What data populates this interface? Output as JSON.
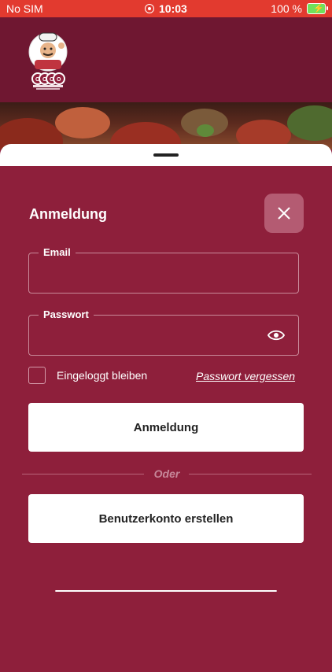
{
  "status_bar": {
    "carrier": "No SIM",
    "time": "10:03",
    "battery": "100 %"
  },
  "header": {
    "logo": {
      "name": "COCO",
      "tagline": "PIZZA & BURGER",
      "subtitle": "Spezialitäten"
    },
    "user_icon": "user-icon",
    "menu_icon": "hamburger-menu-icon"
  },
  "login": {
    "title": "Anmeldung",
    "close_icon": "close-icon",
    "email_label": "Email",
    "email_value": "",
    "password_label": "Passwort",
    "password_value": "",
    "remember_label": "Eingeloggt bleiben",
    "remember_checked": false,
    "forgot_label": "Passwort vergessen",
    "login_button": "Anmeldung",
    "or_text": "Oder",
    "register_button": "Benutzerkonto erstellen"
  },
  "colors": {
    "primary": "#8e1f3b",
    "header": "#6f1731",
    "status": "#e23a2f"
  }
}
